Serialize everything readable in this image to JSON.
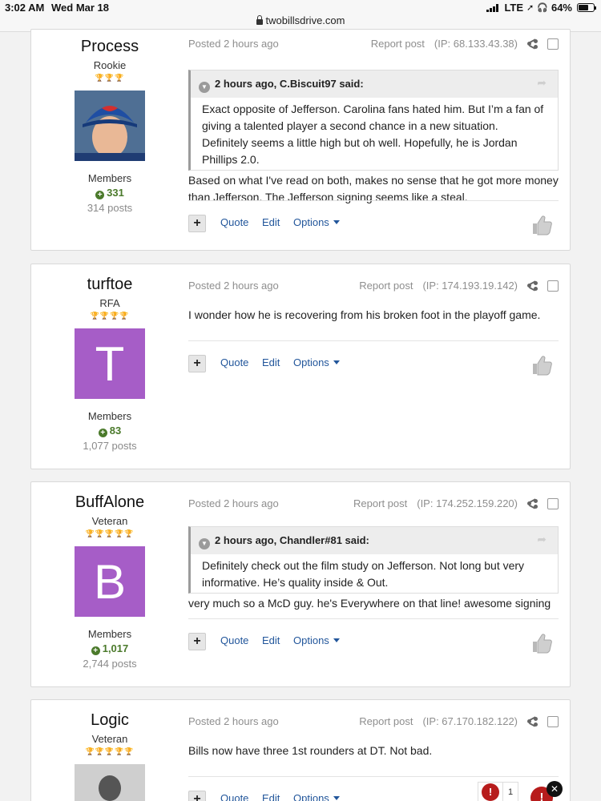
{
  "statusbar": {
    "time": "3:02 AM",
    "date": "Wed Mar 18",
    "network": "LTE",
    "battery": "64%",
    "url": "twobillsdrive.com"
  },
  "common": {
    "report": "Report post",
    "quote": "Quote",
    "edit": "Edit",
    "options": "Options",
    "group": "Members",
    "posted": "Posted 2 hours ago"
  },
  "posts": [
    {
      "author": "Process",
      "rank": "Rookie",
      "pips": "🏆🏆🏆",
      "avatar_letter": "",
      "avatar_color": "#2c4a7a",
      "reputation": "331",
      "post_count": "314 posts",
      "ip": "(IP: 68.133.43.38)",
      "quote": {
        "header": "2 hours ago, C.Biscuit97 said:",
        "text": "Exact opposite of Jefferson. Carolina fans hated him.  But I’m a fan of giving a talented player a second chance in a new situation.  Definitely seems a little high but oh well.  Hopefully, he is Jordan Phillips 2.0."
      },
      "content": "Based on what I've read on both, makes no sense that he got more money than Jefferson. The Jefferson signing seems like a steal."
    },
    {
      "author": "turftoe",
      "rank": "RFA",
      "pips": "🏆🏆🏆🏆",
      "avatar_letter": "T",
      "avatar_color": "#a65dc7",
      "reputation": "83",
      "post_count": "1,077 posts",
      "ip": "(IP: 174.193.19.142)",
      "content": "I wonder how he is recovering from his broken foot in the playoff game."
    },
    {
      "author": "BuffAlone",
      "rank": "Veteran",
      "pips": "🏆🏆🏆🏆🏆",
      "avatar_letter": "B",
      "avatar_color": "#a65dc7",
      "reputation": "1,017",
      "post_count": "2,744 posts",
      "ip": "(IP: 174.252.159.220)",
      "quote": {
        "header": "2 hours ago, Chandler#81 said:",
        "text": "Definitely check out the film study on Jefferson. Not long but very informative. He’s quality inside & Out."
      },
      "content": "very much so a McD guy. he's Everywhere on that line! awesome signing"
    },
    {
      "author": "Logic",
      "rank": "Veteran",
      "pips": "🏆🏆🏆🏆🏆",
      "avatar_letter": "",
      "avatar_color": "#3a3a3a",
      "ip": "(IP: 67.170.182.122)",
      "content": "Bills now have three 1st rounders at DT. Not bad.",
      "reaction_count": "1"
    }
  ],
  "colors": {
    "link": "#22569b",
    "reputation": "#4b7a2b",
    "avatar_purple": "#a65dc7",
    "pips": "#c2185b"
  }
}
